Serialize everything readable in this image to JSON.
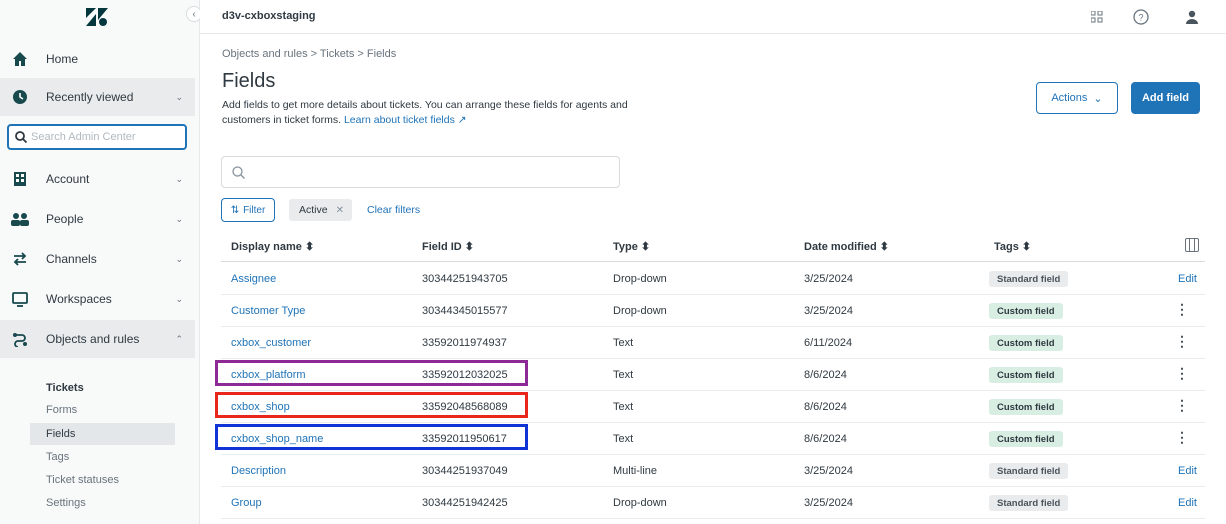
{
  "topbar": {
    "account": "d3v-cxboxstaging"
  },
  "sidebar": {
    "nav": [
      {
        "label": "Home",
        "icon": "home-icon",
        "chevron": ""
      },
      {
        "label": "Recently viewed",
        "icon": "clock-icon",
        "chevron": "⌄"
      },
      {
        "label": "Account",
        "icon": "building-icon",
        "chevron": "⌄"
      },
      {
        "label": "People",
        "icon": "people-icon",
        "chevron": "⌄"
      },
      {
        "label": "Channels",
        "icon": "arrows-icon",
        "chevron": "⌄"
      },
      {
        "label": "Workspaces",
        "icon": "monitor-icon",
        "chevron": "⌄"
      },
      {
        "label": "Objects and rules",
        "icon": "objects-icon",
        "chevron": "⌃"
      }
    ],
    "search_placeholder": "Search Admin Center",
    "subnav": {
      "heading": "Tickets",
      "items": [
        "Forms",
        "Fields",
        "Tags",
        "Ticket statuses",
        "Settings"
      ]
    }
  },
  "main": {
    "breadcrumb": "Objects and rules > Tickets > Fields",
    "title": "Fields",
    "description": "Add fields to get more details about tickets. You can arrange these fields for agents and customers in ticket forms.",
    "learn_link": "Learn about ticket fields ↗",
    "actions_label": "Actions",
    "add_field_label": "Add field",
    "filter_label": "Filter",
    "active_chip": "Active",
    "clear_filters": "Clear filters"
  },
  "table": {
    "columns": [
      "Display name",
      "Field ID",
      "Type",
      "Date modified",
      "Tags"
    ],
    "rows": [
      {
        "name": "Assignee",
        "id": "30344251943705",
        "type": "Drop-down",
        "date": "3/25/2024",
        "tag": "Standard field",
        "action": "Edit"
      },
      {
        "name": "Customer Type",
        "id": "30344345015577",
        "type": "Drop-down",
        "date": "3/25/2024",
        "tag": "Custom field",
        "action": "⋮"
      },
      {
        "name": "cxbox_customer",
        "id": "33592011974937",
        "type": "Text",
        "date": "6/11/2024",
        "tag": "Custom field",
        "action": "⋮"
      },
      {
        "name": "cxbox_platform",
        "id": "33592012032025",
        "type": "Text",
        "date": "8/6/2024",
        "tag": "Custom field",
        "action": "⋮"
      },
      {
        "name": "cxbox_shop",
        "id": "33592048568089",
        "type": "Text",
        "date": "8/6/2024",
        "tag": "Custom field",
        "action": "⋮"
      },
      {
        "name": "cxbox_shop_name",
        "id": "33592011950617",
        "type": "Text",
        "date": "8/6/2024",
        "tag": "Custom field",
        "action": "⋮"
      },
      {
        "name": "Description",
        "id": "30344251937049",
        "type": "Multi-line",
        "date": "3/25/2024",
        "tag": "Standard field",
        "action": "Edit"
      },
      {
        "name": "Group",
        "id": "30344251942425",
        "type": "Drop-down",
        "date": "3/25/2024",
        "tag": "Standard field",
        "action": "Edit"
      }
    ]
  },
  "highlights": [
    {
      "row": 3,
      "color": "#8e2a96"
    },
    {
      "row": 4,
      "color": "#e8261b"
    },
    {
      "row": 5,
      "color": "#1033d6"
    }
  ],
  "colors": {
    "accent": "#1f73b7",
    "custom_tag": "#d9eee3",
    "standard_tag": "#e9ebed"
  }
}
